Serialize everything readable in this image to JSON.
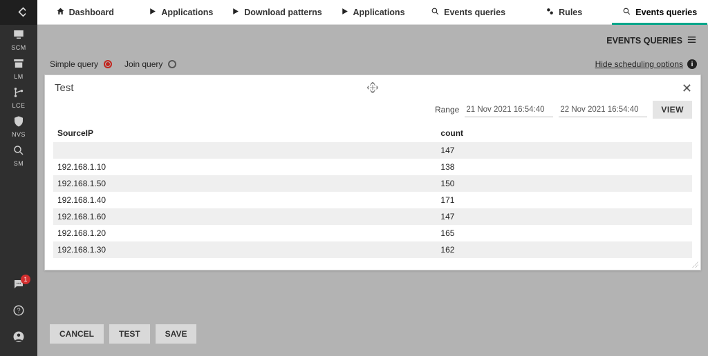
{
  "sidebar": {
    "items": [
      {
        "label": "SCM"
      },
      {
        "label": "LM"
      },
      {
        "label": "LCE"
      },
      {
        "label": "NVS"
      },
      {
        "label": "SM"
      }
    ],
    "chat_badge": "1"
  },
  "topnav": {
    "tabs": [
      {
        "label": "Dashboard"
      },
      {
        "label": "Applications"
      },
      {
        "label": "Download patterns"
      },
      {
        "label": "Applications"
      },
      {
        "label": "Events queries"
      },
      {
        "label": "Rules"
      },
      {
        "label": "Events queries"
      }
    ]
  },
  "subheader": {
    "title": "EVENTS QUERIES"
  },
  "mode": {
    "simple_label": "Simple query",
    "join_label": "Join query"
  },
  "scheduling": {
    "label": "Hide scheduling options"
  },
  "panel": {
    "title": "Test",
    "range_label": "Range",
    "range_from": "21 Nov 2021 16:54:40",
    "range_to": "22 Nov 2021 16:54:40",
    "view_label": "VIEW",
    "columns": {
      "ip": "SourceIP",
      "count": "count"
    },
    "rows": [
      {
        "ip": "",
        "count": "147"
      },
      {
        "ip": "192.168.1.10",
        "count": "138"
      },
      {
        "ip": "192.168.1.50",
        "count": "150"
      },
      {
        "ip": "192.168.1.40",
        "count": "171"
      },
      {
        "ip": "192.168.1.60",
        "count": "147"
      },
      {
        "ip": "192.168.1.20",
        "count": "165"
      },
      {
        "ip": "192.168.1.30",
        "count": "162"
      }
    ]
  },
  "footer": {
    "cancel": "CANCEL",
    "test": "TEST",
    "save": "SAVE"
  }
}
